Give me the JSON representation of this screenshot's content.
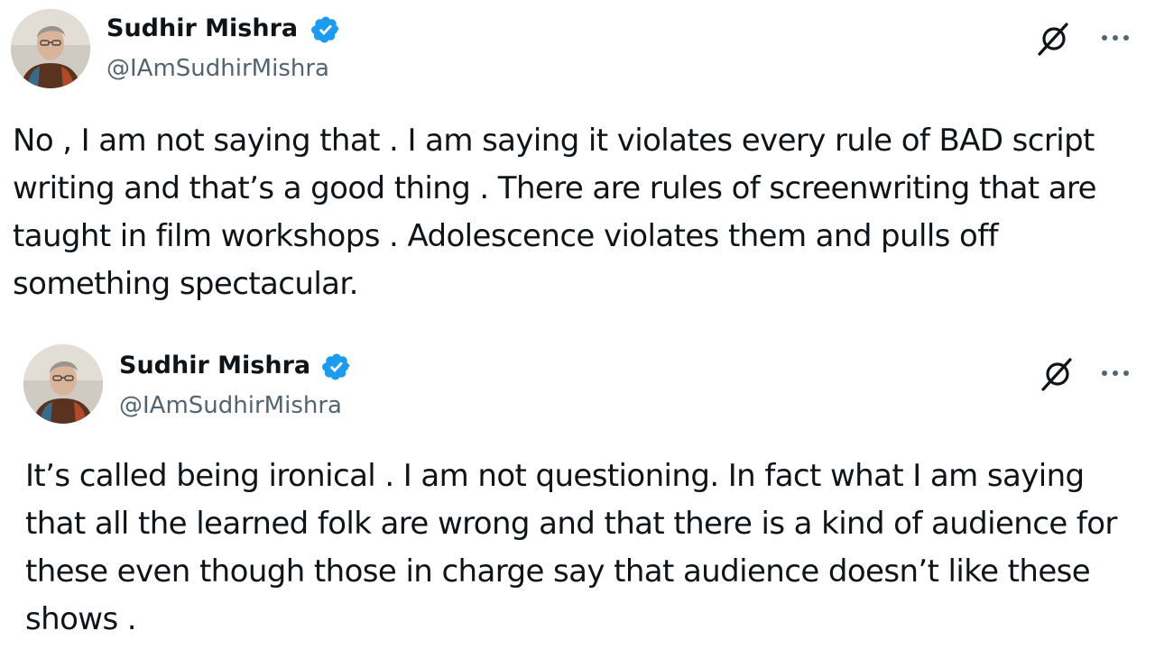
{
  "tweets": [
    {
      "author": {
        "display_name": "Sudhir Mishra",
        "handle": "@IAmSudhirMishra",
        "verified": true,
        "avatar_icon": "profile-photo"
      },
      "text": "No , I am not saying that . I am saying it violates every rule of BAD script\nwriting and that’s a good thing . There are rules of screenwriting that are\ntaught in film workshops . Adolescence violates them and pulls off\nsomething spectacular.",
      "actions": {
        "grok_icon": "grok-icon",
        "more_icon": "more-options-icon"
      }
    },
    {
      "author": {
        "display_name": "Sudhir Mishra",
        "handle": "@IAmSudhirMishra",
        "verified": true,
        "avatar_icon": "profile-photo"
      },
      "text": "It’s called being ironical . I am not questioning. In fact what I am saying\nthat all the learned folk are wrong and that there is a kind of audience for\nthese even though those in charge say that audience doesn’t like these\nshows .",
      "actions": {
        "grok_icon": "grok-icon",
        "more_icon": "more-options-icon"
      }
    }
  ],
  "colors": {
    "text_primary": "#0f1419",
    "text_secondary": "#536471",
    "verified_blue": "#1d9bf0",
    "background": "#ffffff"
  }
}
